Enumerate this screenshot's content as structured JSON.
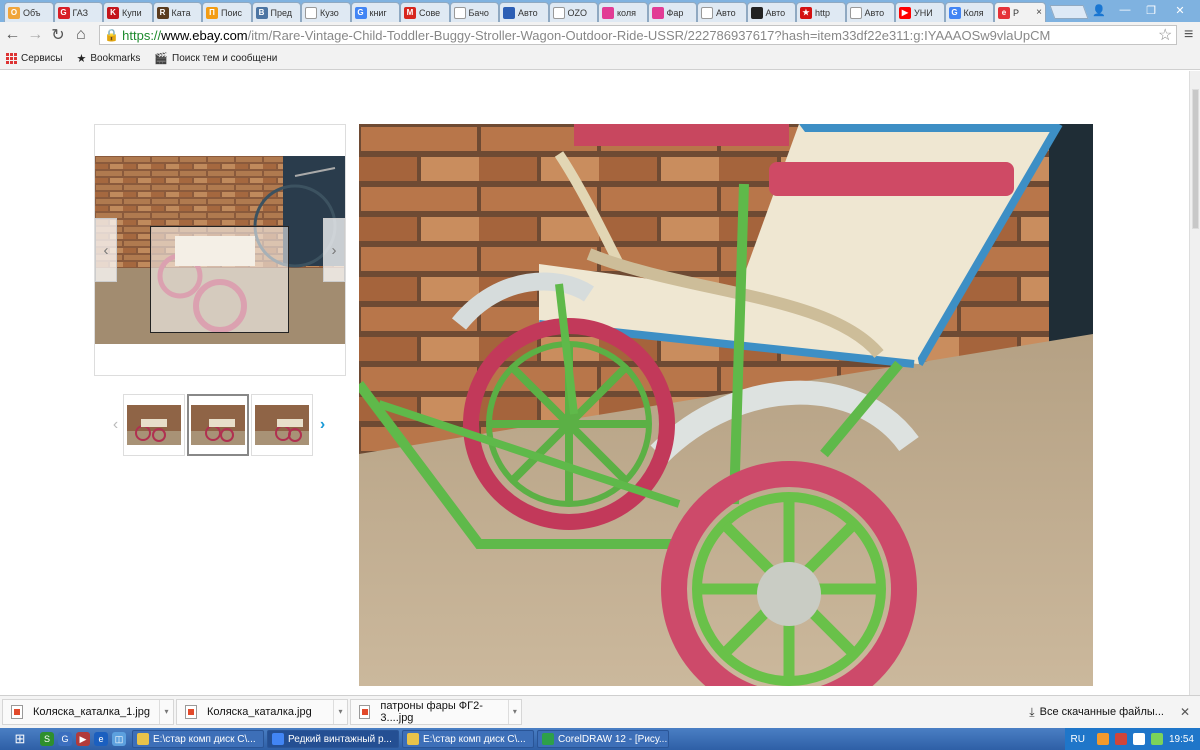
{
  "tabs": [
    {
      "label": "Объ",
      "color": "#f0a53b",
      "glyph": "O"
    },
    {
      "label": "ГАЗ",
      "color": "#d81f26",
      "glyph": "G"
    },
    {
      "label": "Купи",
      "color": "#c4161c",
      "glyph": "K"
    },
    {
      "label": "Ката",
      "color": "#5a3b1e",
      "glyph": "R"
    },
    {
      "label": "Поис",
      "color": "#f39c12",
      "glyph": "П"
    },
    {
      "label": "Пред",
      "color": "#4c75a3",
      "glyph": "B"
    },
    {
      "label": "Кузо",
      "color": "#ffffff",
      "glyph": ""
    },
    {
      "label": "книг",
      "color": "#4285f4",
      "glyph": "G"
    },
    {
      "label": "Сове",
      "color": "#d7261e",
      "glyph": "M"
    },
    {
      "label": "Бачо",
      "color": "#ffffff",
      "glyph": ""
    },
    {
      "label": "Авто",
      "color": "#2d5fb5",
      "glyph": ""
    },
    {
      "label": "OZO",
      "color": "#ffffff",
      "glyph": ""
    },
    {
      "label": "коля",
      "color": "#e23c95",
      "glyph": ""
    },
    {
      "label": "Фар",
      "color": "#e23c95",
      "glyph": ""
    },
    {
      "label": "Авто",
      "color": "#ffffff",
      "glyph": ""
    },
    {
      "label": "Авто",
      "color": "#222222",
      "glyph": ""
    },
    {
      "label": "http",
      "color": "#d41111",
      "glyph": "★"
    },
    {
      "label": "Авто",
      "color": "#ffffff",
      "glyph": ""
    },
    {
      "label": "УНИ",
      "color": "#ff0000",
      "glyph": "▶"
    },
    {
      "label": "Коля",
      "color": "#4285f4",
      "glyph": "G"
    },
    {
      "label": "Р",
      "color": "#e53238",
      "glyph": "e",
      "active": true
    }
  ],
  "toolbar": {
    "back": "←",
    "forward": "→",
    "reload": "↻",
    "home": "⌂",
    "url_scheme": "https://",
    "url_host": "www.ebay.com",
    "url_path": "/itm/Rare-Vintage-Child-Toddler-Buggy-Stroller-Wagon-Outdoor-Ride-USSR/222786937617?hash=item33df22e311:g:IYAAAOSw9vlaUpCM"
  },
  "bookmarks": {
    "apps_label": "Сервисы",
    "bookmarks_label": "Bookmarks",
    "forum_label": "Поиск тем и сообщени"
  },
  "gallery": {
    "thumb_count": 3,
    "selected_index": 1
  },
  "downloads": {
    "items": [
      {
        "name": "Коляска_каталка_1.jpg"
      },
      {
        "name": "Коляска_каталка.jpg"
      },
      {
        "name": "патроны фары ФГ2-3....jpg"
      }
    ],
    "show_all": "Все скачанные файлы..."
  },
  "taskbar": {
    "buttons": [
      {
        "label": "E:\\стар комп диск C\\...",
        "color": "#e8c34a"
      },
      {
        "label": "Редкий винтажный р...",
        "color": "#4285f4",
        "active": true
      },
      {
        "label": "E:\\стар комп диск C\\...",
        "color": "#e8c34a"
      },
      {
        "label": "CorelDRAW 12 - [Рису...",
        "color": "#2ea04a"
      }
    ],
    "lang": "RU",
    "clock": "19:54"
  }
}
